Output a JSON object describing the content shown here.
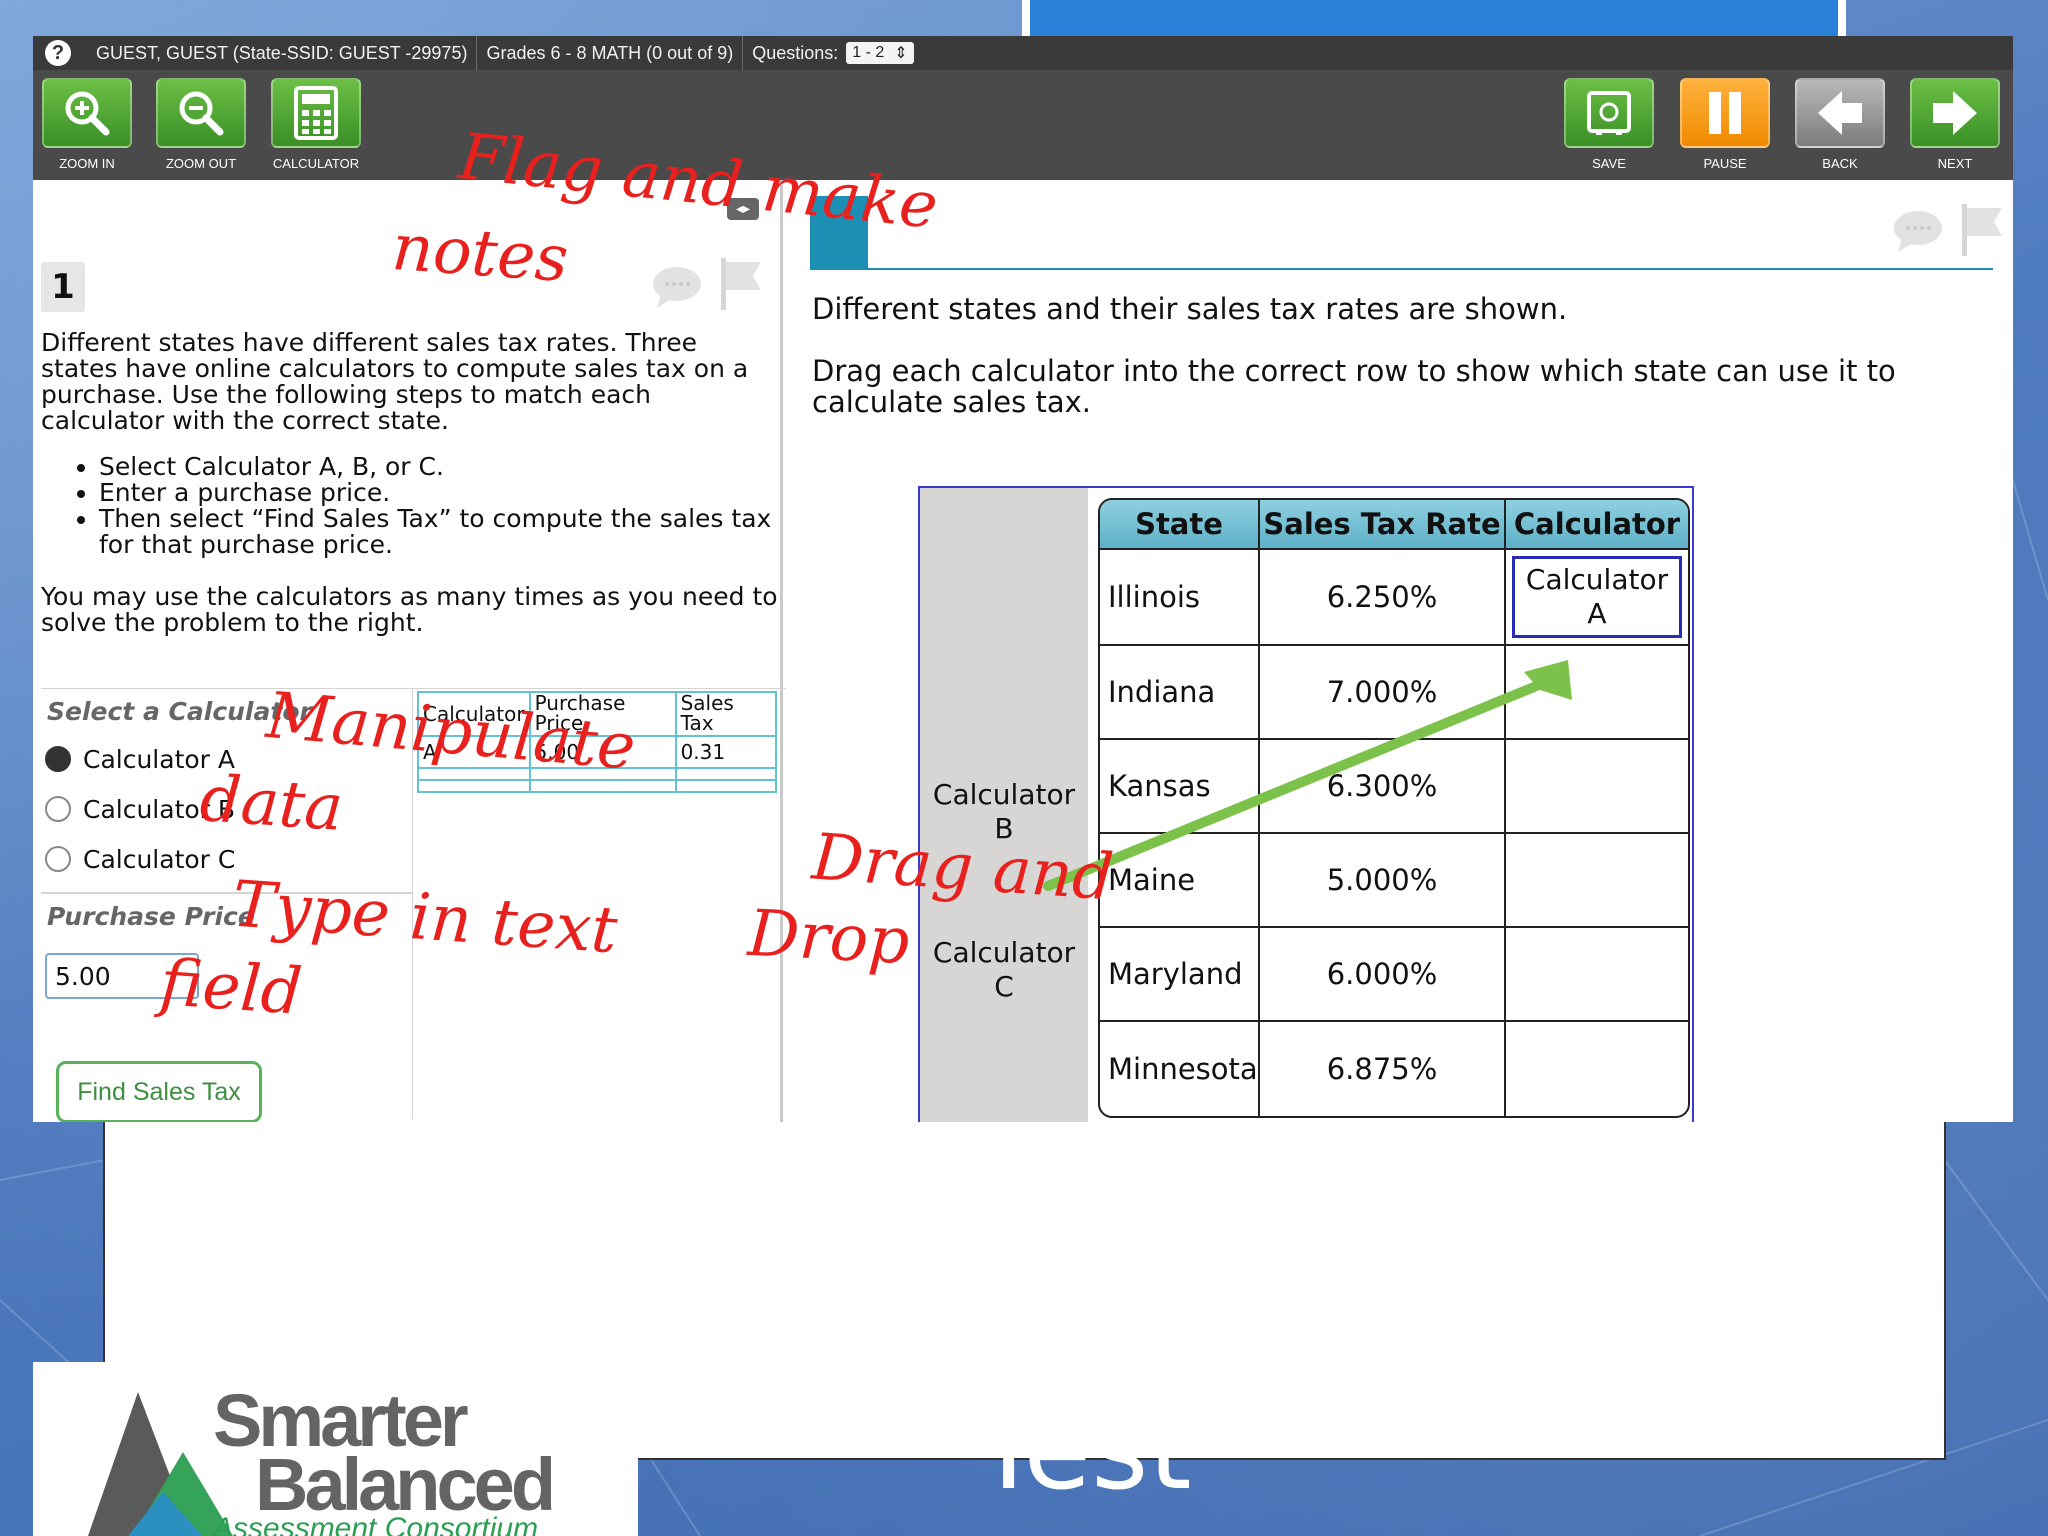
{
  "status_bar": {
    "help": "?",
    "user": "GUEST, GUEST (State-SSID: GUEST -29975)",
    "test": "Grades 6 - 8 MATH (0 out of 9)",
    "questions_label": "Questions:",
    "questions_value": "1 - 2"
  },
  "toolbar": {
    "zoom_in": "ZOOM IN",
    "zoom_out": "ZOOM OUT",
    "calculator": "CALCULATOR",
    "save": "SAVE",
    "pause": "PAUSE",
    "back": "BACK",
    "next": "NEXT"
  },
  "passage": {
    "number": "1",
    "intro": "Different states have different sales tax rates. Three states have online calculators to compute sales tax on a purchase. Use the following steps to match each calculator with the correct state.",
    "steps": [
      "Select Calculator A, B, or C.",
      "Enter a purchase price.",
      "Then select “Find Sales Tax” to compute the sales tax for that purchase price."
    ],
    "outro": "You may use the calculators as many times as you need to solve the problem to the right."
  },
  "calculator_widget": {
    "select_heading": "Select a Calculator",
    "options": [
      "Calculator A",
      "Calculator B",
      "Calculator C"
    ],
    "selected": "Calculator A",
    "price_heading": "Purchase Price",
    "price_value": "5.00",
    "button": "Find Sales Tax",
    "table_headers": [
      "Calculator",
      "Purchase Price",
      "Sales Tax"
    ],
    "table_rows": [
      [
        "A",
        "5.00",
        "0.31"
      ],
      [
        "",
        "",
        ""
      ]
    ]
  },
  "item": {
    "line1": "Different states and their sales tax rates are shown.",
    "line2": "Drag each calculator into the correct row to show which state can use it to calculate sales tax.",
    "tray": [
      "Calculator B",
      "Calculator C"
    ],
    "headers": [
      "State",
      "Sales Tax Rate",
      "Calculator"
    ],
    "rows": [
      {
        "state": "Illinois",
        "rate": "6.250%",
        "calc": "Calculator A"
      },
      {
        "state": "Indiana",
        "rate": "7.000%",
        "calc": ""
      },
      {
        "state": "Kansas",
        "rate": "6.300%",
        "calc": ""
      },
      {
        "state": "Maine",
        "rate": "5.000%",
        "calc": ""
      },
      {
        "state": "Maryland",
        "rate": "6.000%",
        "calc": ""
      },
      {
        "state": "Minnesota",
        "rate": "6.875%",
        "calc": ""
      }
    ]
  },
  "annotations": {
    "flag_notes_1": "Flag and make",
    "flag_notes_2": "notes",
    "manipulate_1": "Manipulate",
    "manipulate_2": "data",
    "type_1": "Type in text",
    "type_2": "field",
    "drag_1": "Drag and",
    "drag_2": "Drop",
    "color": "#e8201e",
    "arrow_color": "#7cc24a"
  },
  "slide": {
    "title_fragment": "Test",
    "logo_line1": "Smarter",
    "logo_line2": "Balanced",
    "logo_line3": "Assessment Consortium"
  }
}
